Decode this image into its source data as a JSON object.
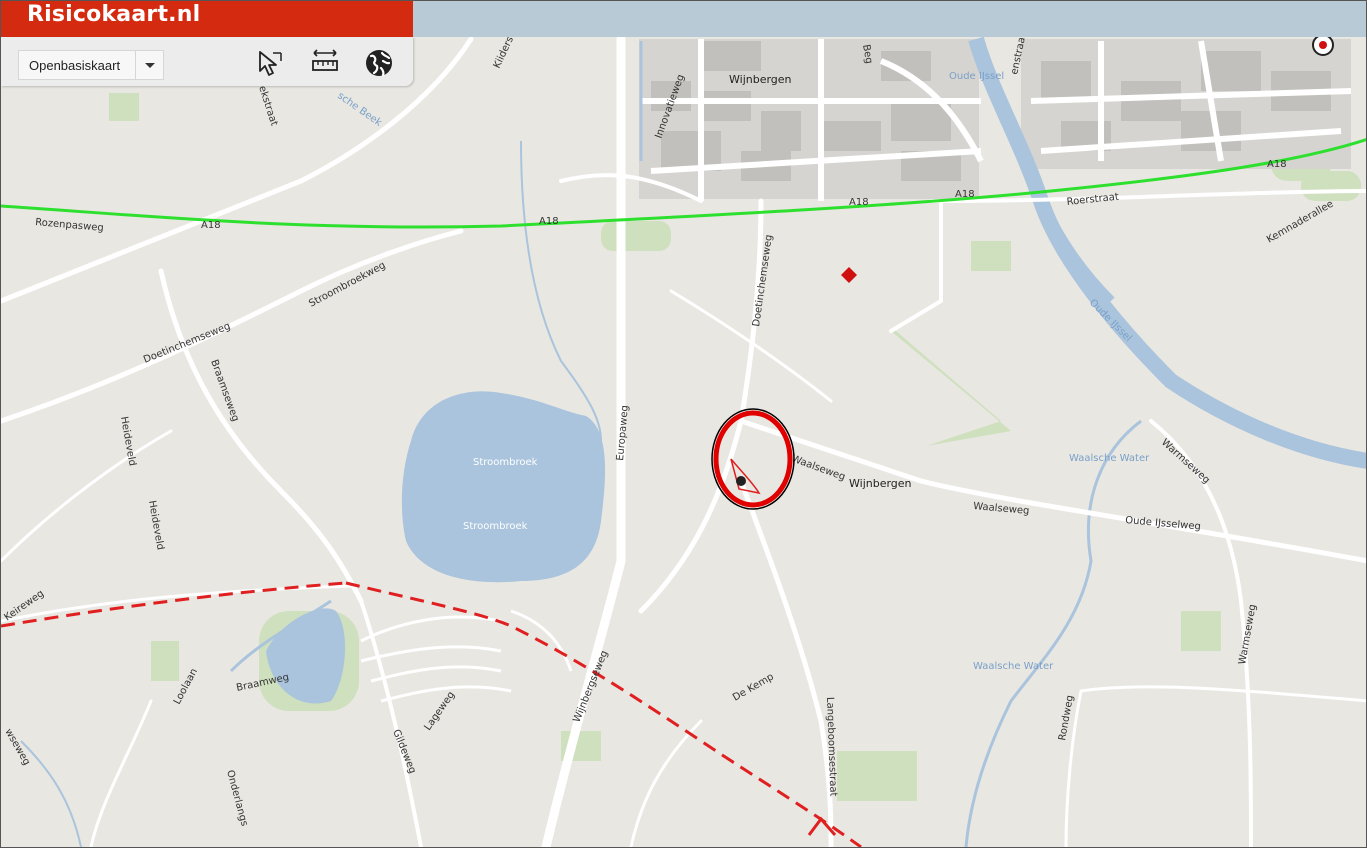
{
  "app": {
    "title": "Risicokaart.nl"
  },
  "toolbar": {
    "basemap_value": "Openbasiskaart",
    "tools": [
      "select-pointer-icon",
      "measure-ruler-icon",
      "globe-icon"
    ]
  },
  "map": {
    "labels": {
      "wijnbergen_top": "Wijnbergen",
      "wijnbergen_center": "Wijnbergen",
      "oude_ijssel_top": "Oude IJssel",
      "oude_ijssel_river": "Oude IJssel",
      "a18_1": "A18",
      "a18_2": "A18",
      "a18_3": "A18",
      "a18_4": "A18",
      "a18_5": "A18",
      "rozenpasweg": "Rozenpasweg",
      "stroombroekweg": "Stroombroekweg",
      "doetinchemseweg_w": "Doetinchemseweg",
      "doetinchemseweg_n": "Doetinchemseweg",
      "braamseweg": "Braamseweg",
      "heideveld_1": "Heideveld",
      "heideveld_2": "Heideveld",
      "europaweg": "Europaweg",
      "stroombroek_1": "Stroombroek",
      "stroombroek_2": "Stroombroek",
      "waalseweg_1": "Waalseweg",
      "waalseweg_2": "Waalseweg",
      "oude_ijsselweg": "Oude IJsselweg",
      "warmseweg_1": "Warmseweg",
      "warmseweg_2": "Warmseweg",
      "waalsche_water_1": "Waalsche Water",
      "waalsche_water_2": "Waalsche Water",
      "roerstraat": "Roerstraat",
      "kemnaderallee": "Kemnaderallee",
      "innovatieweg": "Innovatieweg",
      "kiidersweg": "Kiidersweg",
      "bedrijfsstraat": "Beg",
      "eekstraat": "ekstraat",
      "keireweg": "Keireweg",
      "loolaan": "Loolaan",
      "braamweg": "Braamweg",
      "gildeweg": "Gildeweg",
      "lageweg": "Lageweg",
      "wijnbergseweg": "Wijnbergseweg",
      "de_kemp": "De Kemp",
      "langeboomsestraat": "Langeboomsestraat",
      "rondweg": "Rondweg",
      "onderlangs": "Onderlangs",
      "wseweg": "wseweg",
      "vsche_beek": "sche Beek",
      "nstraat": "enstraat"
    },
    "markers": [
      "risk-point-marker",
      "highlight-ellipse",
      "red-diamond-marker"
    ],
    "colors": {
      "header": "#d42a10",
      "highway": "#2ee02e",
      "pipeline": "#e02020",
      "water": "#a9c4dc",
      "highlight": "#e00000"
    }
  }
}
